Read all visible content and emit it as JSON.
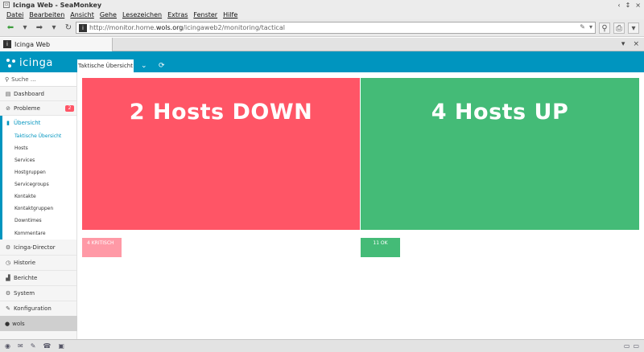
{
  "window": {
    "title": "Icinga Web - SeaMonkey",
    "controls": [
      "‹",
      "↕",
      "×"
    ]
  },
  "menu": [
    "Datei",
    "Bearbeiten",
    "Ansicht",
    "Gehe",
    "Lesezeichen",
    "Extras",
    "Fenster",
    "Hilfe"
  ],
  "nav": {
    "url_prefix": "http://monitor.home.",
    "url_domain": "wols.org",
    "url_path": "/icingaweb2/monitoring/tactical"
  },
  "browser_tab": {
    "label": "Icinga Web"
  },
  "app": {
    "logo_text": "icinga",
    "content_tab": "Taktische Übersicht"
  },
  "sidebar": {
    "search_placeholder": "Suche ...",
    "dashboard": "Dashboard",
    "problems": "Probleme",
    "problems_count": "2",
    "overview": "Übersicht",
    "sub_items": [
      "Taktische Übersicht",
      "Hosts",
      "Services",
      "Hostgruppen",
      "Servicegroups",
      "Kontakte",
      "Kontaktgruppen",
      "Downtimes",
      "Kommentare"
    ],
    "director": "Icinga-Director",
    "history": "Historie",
    "reports": "Berichte",
    "system": "System",
    "config": "Konfiguration",
    "user": "wols"
  },
  "tactical": {
    "down_label": "2 Hosts DOWN",
    "up_label": "4 Hosts UP",
    "critical_chip": "4 KRITISCH",
    "ok_chip": "11 OK"
  },
  "colors": {
    "header": "#0095bf",
    "down": "#ff5566",
    "up": "#44bb77",
    "critical_chip": "#ff99a6"
  }
}
